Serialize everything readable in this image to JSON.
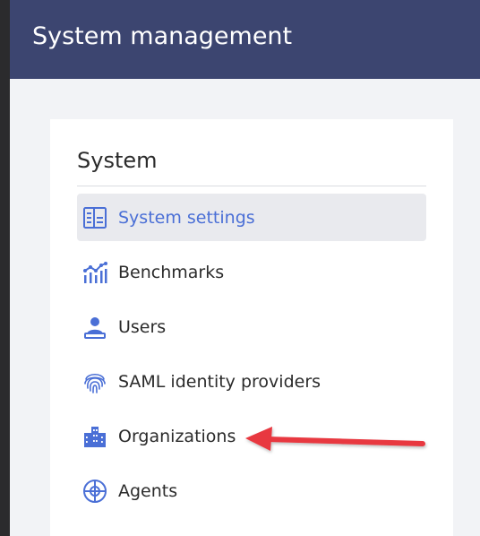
{
  "header": {
    "title": "System management"
  },
  "panel": {
    "title": "System",
    "items": [
      {
        "label": "System settings",
        "icon": "system-settings-icon",
        "active": true
      },
      {
        "label": "Benchmarks",
        "icon": "benchmarks-icon",
        "active": false
      },
      {
        "label": "Users",
        "icon": "users-icon",
        "active": false
      },
      {
        "label": "SAML identity providers",
        "icon": "fingerprint-icon",
        "active": false
      },
      {
        "label": "Organizations",
        "icon": "organizations-icon",
        "active": false
      },
      {
        "label": "Agents",
        "icon": "agents-icon",
        "active": false
      }
    ]
  },
  "colors": {
    "header_bg": "#3c4570",
    "accent": "#4a6fd6",
    "active_bg": "#e9eaee",
    "annotation_arrow": "#e8373f"
  }
}
